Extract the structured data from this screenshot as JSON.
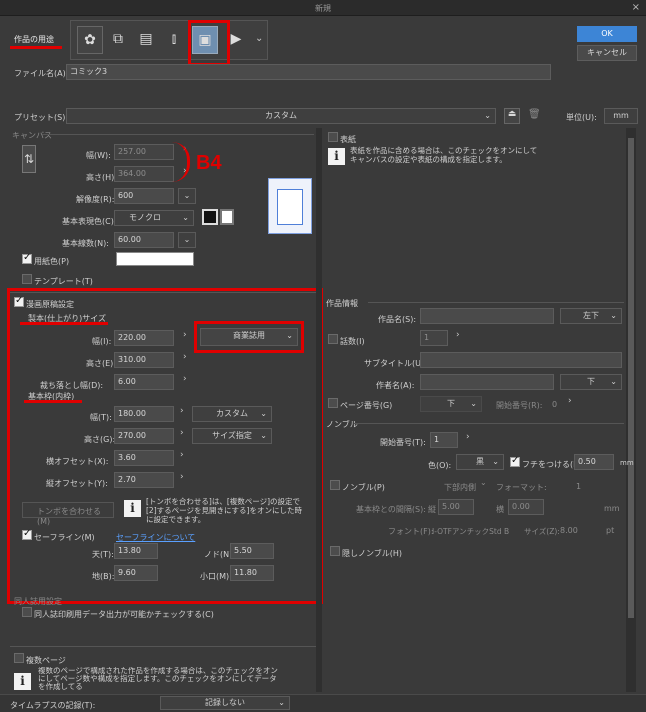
{
  "window": {
    "title": "新規",
    "close_glyph": "×"
  },
  "purpose": {
    "label": "作品の用途"
  },
  "header": {
    "ok_label": "OK",
    "cancel_label": "キャンセル"
  },
  "file": {
    "label": "ファイル名(A):",
    "value": "コミック3"
  },
  "preset": {
    "label": "プリセット(S):",
    "value": "カスタム",
    "unit_label": "単位(U):",
    "unit_value": "mm"
  },
  "canvas": {
    "section_label": "キャンバス",
    "width_label": "幅(W):",
    "width_value": "257.00",
    "height_label": "高さ(H):",
    "height_value": "364.00",
    "size_annotation": "B4",
    "resolution_label": "解像度(R):",
    "resolution_value": "600",
    "color_label": "基本表現色(C):",
    "color_value": "モノクロ",
    "lines_label": "基本線数(N):",
    "lines_value": "60.00",
    "paper_color_label": "用紙色(P)",
    "template_label": "テンプレート(T)"
  },
  "manga": {
    "section_label": "漫画原稿設定",
    "binding": {
      "label": "製本(仕上がり)サイズ",
      "width_label": "幅(I):",
      "width_value": "220.00",
      "preset_value": "商業誌用",
      "height_label": "高さ(E):",
      "height_value": "310.00",
      "bleed_label": "裁ち落とし幅(D):",
      "bleed_value": "6.00"
    },
    "frame": {
      "label": "基本枠(内枠)",
      "width_label": "幅(T):",
      "width_value": "180.00",
      "width_select": "カスタム",
      "height_label": "高さ(G):",
      "height_value": "270.00",
      "height_select": "サイズ指定",
      "xoffset_label": "横オフセット(X):",
      "xoffset_value": "3.60",
      "yoffset_label": "縦オフセット(Y):",
      "yoffset_value": "2.70"
    },
    "tombo_label": "トンボを合わせる(M)",
    "tombo_info": "[トンボを合わせる]は、[複数ページ]の設定で[2]するページを見開きにする]をオンにした時に設定できます。",
    "safe": {
      "label": "セーフライン(M)",
      "link": "セーフラインについて",
      "top_label": "天(T):",
      "top_value": "13.80",
      "gutter_label": "ノド(N):",
      "gutter_value": "5.50",
      "bottom_label": "地(B):",
      "bottom_value": "9.60",
      "fore_label": "小口(M):",
      "fore_value": "11.80"
    }
  },
  "doujin": {
    "section_label": "同人誌用設定",
    "check_label": "同人誌印刷用データ出力が可能かチェックする(C)"
  },
  "multipage": {
    "label": "複数ページ",
    "info": "複数のページで構成された作品を作成する場合は、このチェックをオンにしてページ数や構成を指定します。このチェックをオンにしてデータを作成してる"
  },
  "timelapse": {
    "label": "タイムラプスの記録(T):",
    "value": "記録しない"
  },
  "cover": {
    "label": "表紙",
    "info": "表紙を作品に含める場合は、このチェックをオンにしてキャンバスの設定や表紙の構成を指定します。"
  },
  "work_info": {
    "section_label": "作品情報",
    "title_label": "作品名(S):",
    "title_pos": "左下",
    "episode_label": "話数(I)",
    "episode_value": "1",
    "subtitle_label": "サブタイトル(U):",
    "author_label": "作者名(A):",
    "author_pos": "下",
    "pagenum_label": "ページ番号(G)",
    "pagenum_pos": "下",
    "start_label": "開始番号(R):",
    "start_value": "0"
  },
  "nombre": {
    "section_label": "ノンブル",
    "start_label": "開始番号(T):",
    "start_value": "1",
    "color_label": "色(O):",
    "color_value": "黒",
    "outline_label": "フチをつける(E)",
    "outline_value": "0.50",
    "outline_unit": "mm",
    "hidden_label": "ノンブル(P)",
    "hidden_pos": "下部内側",
    "format_label": "フォーマット:",
    "format_value": "1",
    "gap_label": "基本枠との間隔(S):",
    "gap_v_label": "縦",
    "gap_v_value": "5.00",
    "gap_h_label": "横",
    "gap_h_value": "0.00",
    "gap_unit": "mm",
    "font_label": "フォント(F):",
    "font_value": "I-OTFアンチックStd B",
    "size_label": "サイズ(Z):",
    "size_value": "8.00",
    "size_unit": "pt",
    "secret_label": "隠しノンブル(H)"
  }
}
